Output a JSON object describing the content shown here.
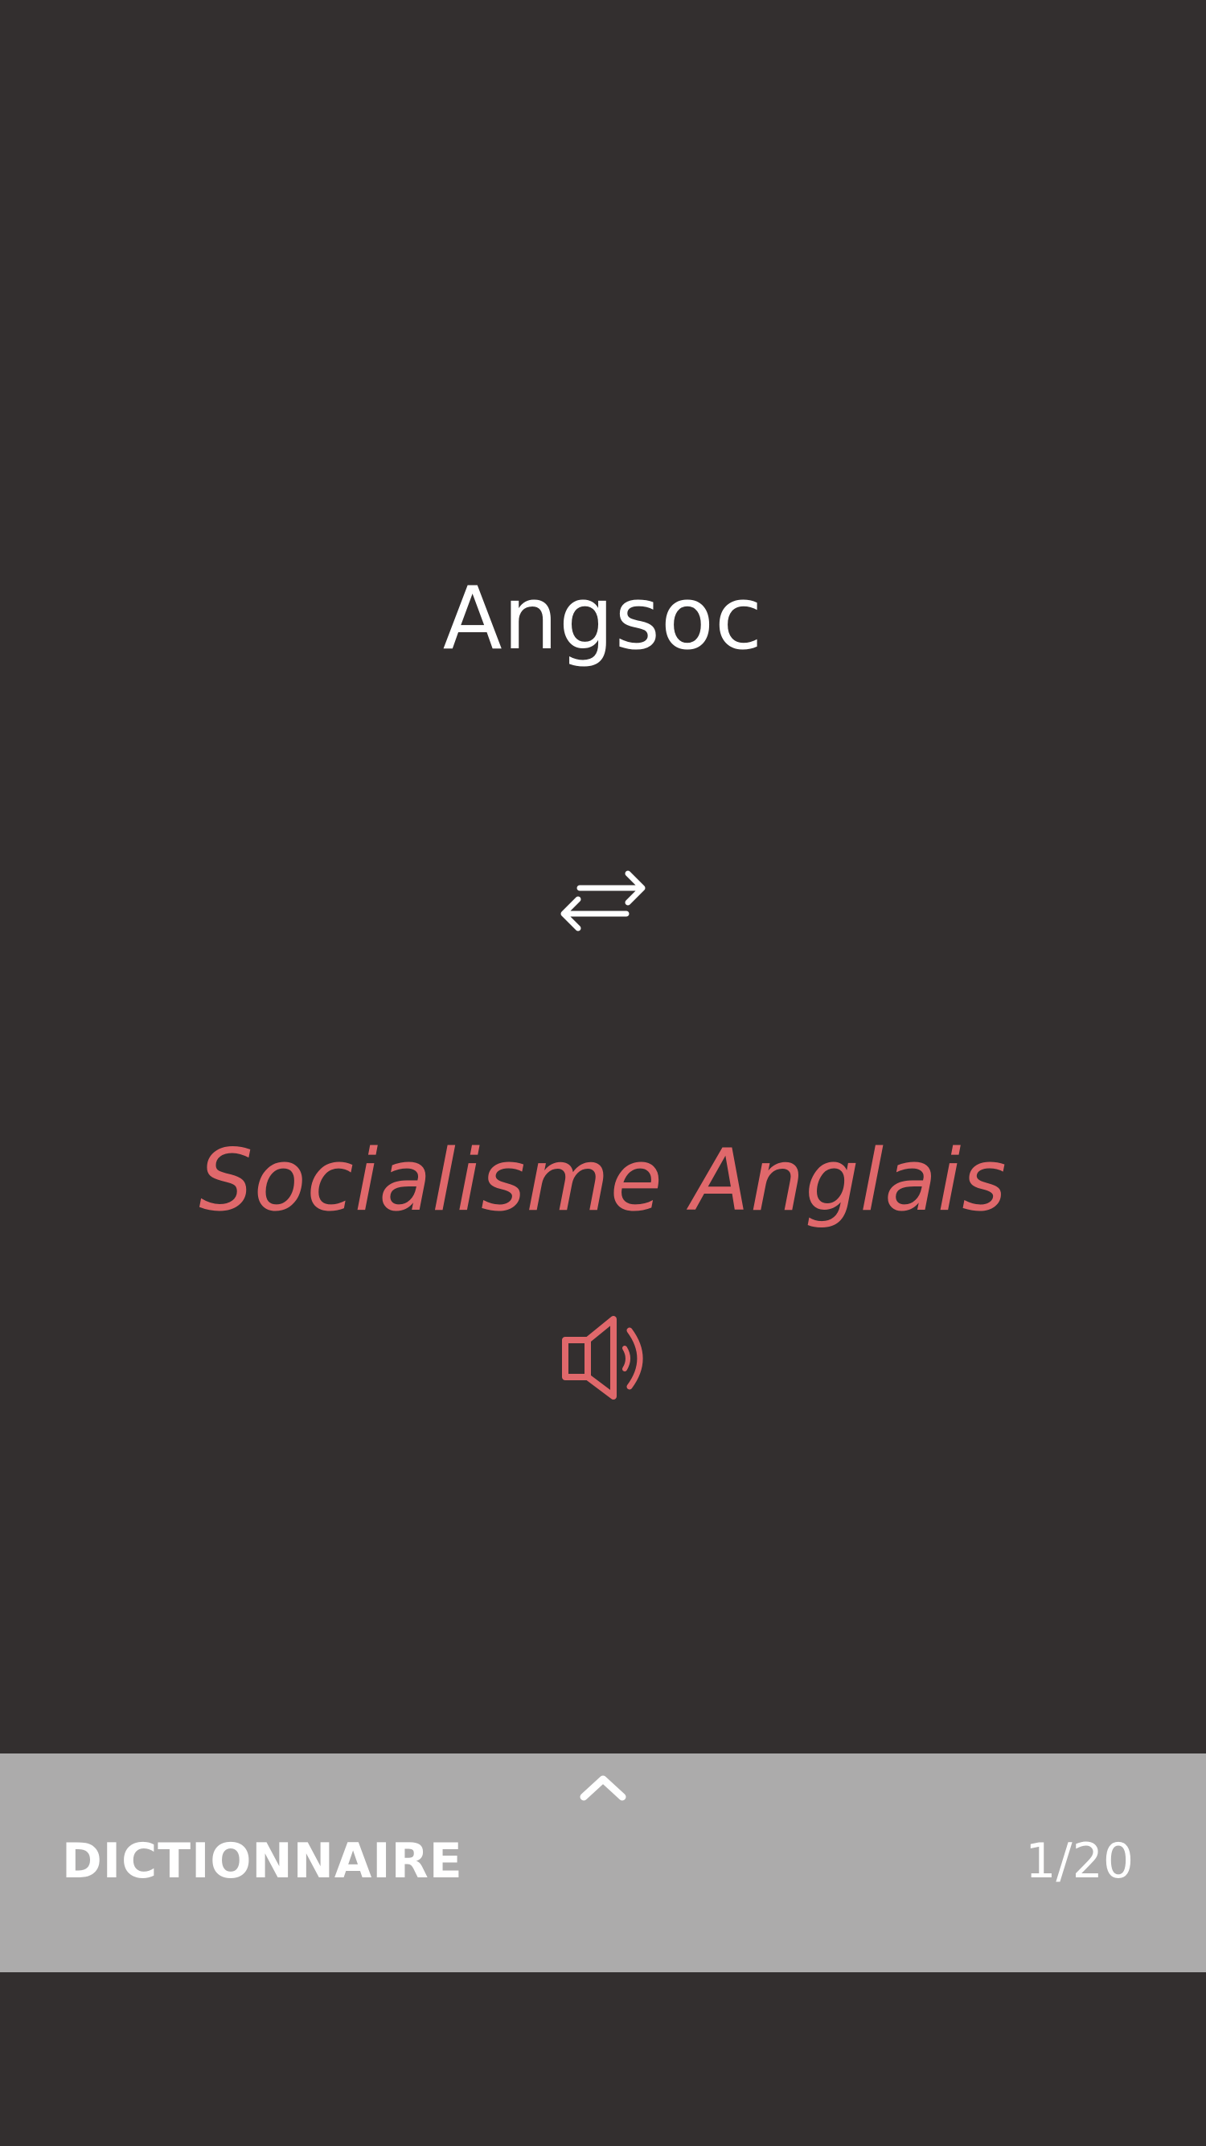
{
  "card": {
    "word": "Angsoc",
    "translation": "Socialisme Anglais",
    "swap_icon": "swap-arrows-icon",
    "audio_icon": "speaker-icon"
  },
  "drawer": {
    "handle_icon": "chevron-up-icon",
    "title": "DICTIONNAIRE",
    "counter": "1/20"
  },
  "colors": {
    "background": "#332f2f",
    "accent": "#e0686b",
    "drawer": "#acabab",
    "text": "#ffffff"
  }
}
